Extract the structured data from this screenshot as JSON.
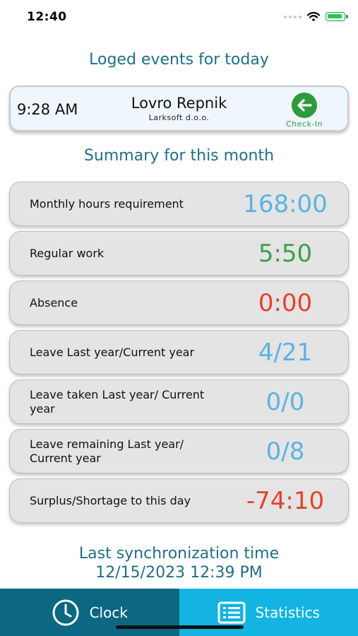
{
  "status_bar": {
    "time": "12:40"
  },
  "events": {
    "title": "Loged events for today",
    "card": {
      "time": "9:28 AM",
      "name": "Lovro Repnik",
      "company": "Larksoft d.o.o.",
      "action": "Check-In",
      "action_icon": "arrow-left-circle-icon"
    }
  },
  "summary": {
    "title": "Summary for this month",
    "rows": [
      {
        "label": "Monthly hours requirement",
        "value": "168:00",
        "color": "#5ab4df"
      },
      {
        "label": "Regular work",
        "value": "5:50",
        "color": "#3aa04a"
      },
      {
        "label": "Absence",
        "value": "0:00",
        "color": "#e8402a"
      },
      {
        "label": "Leave Last year/Current year",
        "value": "4/21",
        "color": "#5ab4df"
      },
      {
        "label": "Leave taken Last year/ Current year",
        "value": "0/0",
        "color": "#5ab4df"
      },
      {
        "label": "Leave remaining Last year/ Current year",
        "value": "0/8",
        "color": "#5ab4df"
      },
      {
        "label": "Surplus/Shortage to this day",
        "value": "-74:10",
        "color": "#e8402a"
      }
    ]
  },
  "sync": {
    "label": "Last synchronization time",
    "time": "12/15/2023 12:39 PM"
  },
  "tabs": [
    {
      "label": "Clock",
      "icon": "clock-icon",
      "color": "#0b6782"
    },
    {
      "label": "Statistics",
      "icon": "list-icon",
      "color": "#13b4e2"
    }
  ]
}
